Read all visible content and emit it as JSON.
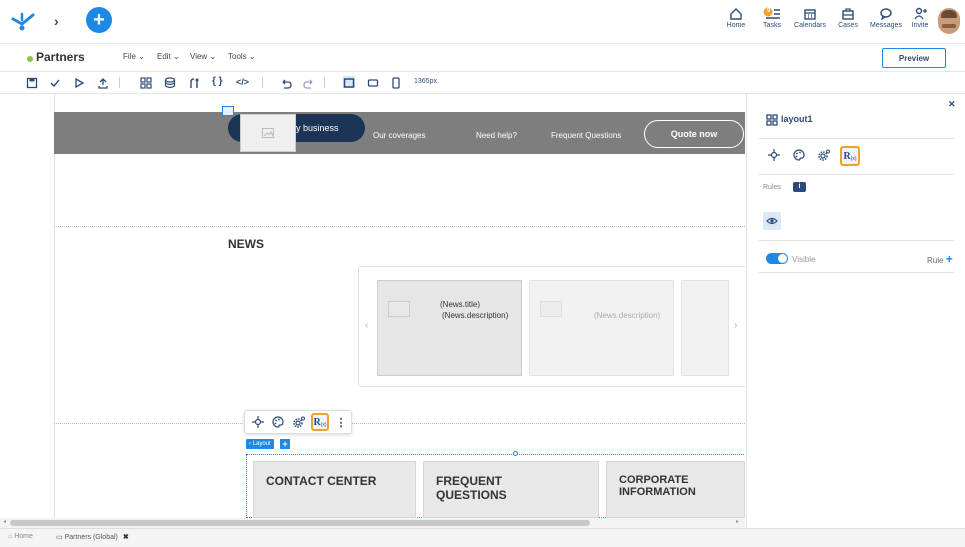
{
  "topbar": {
    "nav": [
      {
        "label": "Home",
        "icon": "home-icon"
      },
      {
        "label": "Tasks",
        "icon": "tasks-icon",
        "badge": "9"
      },
      {
        "label": "Calendars",
        "icon": "calendar-icon"
      },
      {
        "label": "Cases",
        "icon": "cases-icon"
      },
      {
        "label": "Messages",
        "icon": "messages-icon"
      },
      {
        "label": "Invite",
        "icon": "invite-icon"
      }
    ]
  },
  "menubar": {
    "title": "Partners",
    "menus": [
      "File",
      "Edit",
      "View",
      "Tools"
    ],
    "preview_label": "Preview"
  },
  "toolbar": {
    "width_label": "1365px"
  },
  "canvas": {
    "header_nav": {
      "pill_label": "y business",
      "links": [
        "Our coverages",
        "Need help?",
        "Frequent Questions"
      ],
      "quote_label": "Quote now"
    },
    "news_title": "NEWS",
    "news_cards": [
      {
        "title": "(News.title)",
        "description": "(News.description)"
      },
      {
        "description": "(News.description)"
      }
    ],
    "layout_tag": "Layout",
    "layout_add": "+",
    "info_cards": [
      "CONTACT CENTER",
      "FREQUENT QUESTIONS",
      "CORPORATE INFORMATION"
    ]
  },
  "rightpanel": {
    "title": "layout1",
    "rules_label": "Rules",
    "visible_label": "Visible",
    "rule_label": "Rule",
    "visible_toggle_on": true
  },
  "statusbar": {
    "tabs": [
      {
        "label": "Home"
      },
      {
        "label": "Partners (Global)"
      }
    ]
  },
  "colors": {
    "accent": "#1e88e5",
    "navy": "#2d4b7a",
    "highlight": "#f0a030",
    "header_bg": "#7e7e7e",
    "pill_bg": "#1c3557",
    "title_dot": "#8bc34a"
  }
}
